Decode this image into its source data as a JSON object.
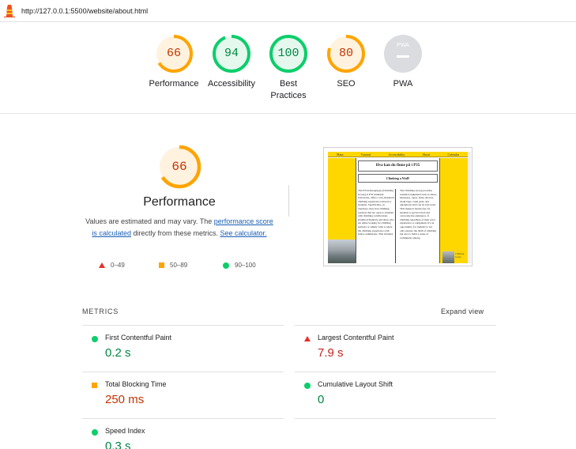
{
  "browser": {
    "url": "http://127.0.0.1:5500/website/about.html"
  },
  "colors": {
    "good": "#0cce6b",
    "average": "#ffa400",
    "fail": "#ff4e42",
    "good_text": "#018642",
    "average_text": "#c33300",
    "fail_text": "#c7221f"
  },
  "categories": [
    {
      "label": "Performance",
      "score": "66",
      "score_value": 66,
      "rating": "average"
    },
    {
      "label": "Accessibility",
      "score": "94",
      "score_value": 94,
      "rating": "good"
    },
    {
      "label": "Best Practices",
      "label_line1": "Best",
      "label_line2": "Practices",
      "score": "100",
      "score_value": 100,
      "rating": "good"
    },
    {
      "label": "SEO",
      "score": "80",
      "score_value": 80,
      "rating": "average"
    },
    {
      "label": "PWA",
      "score": "PWA",
      "rating": "na"
    }
  ],
  "performance": {
    "score": "66",
    "score_value": 66,
    "title": "Performance",
    "note_prefix": "Values are estimated and may vary. The ",
    "note_link1": "performance score is calculated",
    "note_middle": " directly from these metrics. ",
    "note_link2": "See calculator.",
    "legend": [
      {
        "icon": "triangle-red",
        "range": "0–49"
      },
      {
        "icon": "square-orange",
        "range": "50–89"
      },
      {
        "icon": "circle-green",
        "range": "90–100"
      }
    ]
  },
  "thumbnail": {
    "nav": [
      "Main",
      "Tutorial",
      "Accessibility",
      "About",
      "Calendar"
    ],
    "heading": "Hva kan du finne på i P35",
    "subheading": "Climbing a Wall!",
    "col_left": "The P35 Klatregruppa (Climbing Group) at P35 Jønköpin University, offers a low-threshold climbing experience tailored to students. Specifically, on Tuesdays, they host climbing sessions that are open to students with climbing certifications (brattkort/fastkort) and those who are either looking for climbing partners or simply wish to share the climbing experience with fellow enthusiasts. This includes",
    "col_right": "The Climbing Group provides essential equipment such as shoes, harnesses, ropes, belay devices, chalk bags, crash pads, and quickdraws that can be borrowed. This makes it hassle-free for students to get involved and overcome the endurance of climbing regardless of their prior experience or equipment. It's an opportunity for students to not only explore the thrill of climbing but also to build a sense of community among",
    "side_note": "Climbing Group"
  },
  "metrics": {
    "header": "METRICS",
    "expand_label": "Expand view",
    "items": [
      {
        "label": "First Contentful Paint",
        "value": "0.2 s",
        "rating": "good"
      },
      {
        "label": "Largest Contentful Paint",
        "value": "7.9 s",
        "rating": "fail"
      },
      {
        "label": "Total Blocking Time",
        "value": "250 ms",
        "rating": "average"
      },
      {
        "label": "Cumulative Layout Shift",
        "value": "0",
        "rating": "good"
      },
      {
        "label": "Speed Index",
        "value": "0.3 s",
        "rating": "good"
      }
    ]
  }
}
